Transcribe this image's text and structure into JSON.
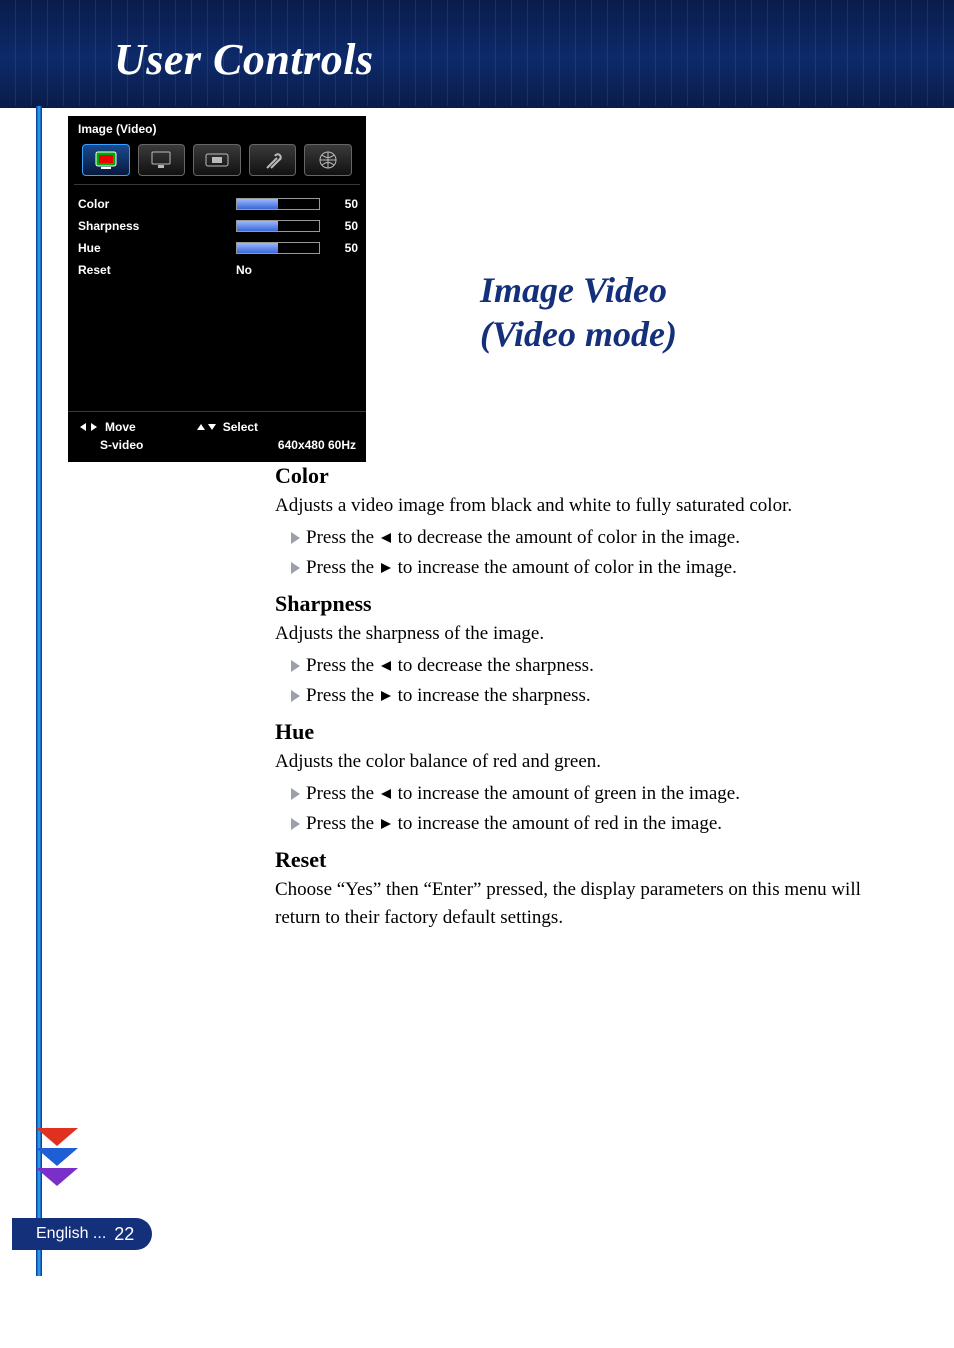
{
  "header": {
    "section_title": "User Controls"
  },
  "osd": {
    "title": "Image (Video)",
    "tabs": [
      {
        "name": "image-video-tab",
        "active": true
      },
      {
        "name": "display-tab",
        "active": false
      },
      {
        "name": "aspect-tab",
        "active": false
      },
      {
        "name": "setup-tab",
        "active": false
      },
      {
        "name": "language-tab",
        "active": false
      }
    ],
    "rows": [
      {
        "label": "Color",
        "type": "slider",
        "value": 50
      },
      {
        "label": "Sharpness",
        "type": "slider",
        "value": 50
      },
      {
        "label": "Hue",
        "type": "slider",
        "value": 50
      },
      {
        "label": "Reset",
        "type": "text",
        "text": "No"
      }
    ],
    "footer": {
      "move_label": "Move",
      "select_label": "Select",
      "source": "S-video",
      "resolution": "640x480 60Hz"
    }
  },
  "doc": {
    "heading_line1": "Image Video",
    "heading_line2": "(Video mode)",
    "sections": [
      {
        "title": "Color",
        "intro": "Adjusts a video image from black and white to fully saturated color.",
        "bullets": [
          {
            "pre": "Press the ",
            "dir": "left",
            "post": " to decrease the amount of color in the image."
          },
          {
            "pre": "Press the ",
            "dir": "right",
            "post": " to increase the amount of color in the image."
          }
        ]
      },
      {
        "title": "Sharpness",
        "intro": "Adjusts the sharpness of the image.",
        "bullets": [
          {
            "pre": "Press the ",
            "dir": "left",
            "post": " to decrease the sharpness."
          },
          {
            "pre": "Press the ",
            "dir": "right",
            "post": " to increase the sharpness."
          }
        ]
      },
      {
        "title": "Hue",
        "intro": "Adjusts the color balance of red and green.",
        "bullets": [
          {
            "pre": "Press the ",
            "dir": "left",
            "post": " to increase the amount of green in the image."
          },
          {
            "pre": "Press the ",
            "dir": "right",
            "post": " to increase the amount of red  in the image."
          }
        ]
      },
      {
        "title": "Reset",
        "intro": "Choose “Yes” then “Enter” pressed, the display parameters on this menu will return to their factory default settings.",
        "bullets": []
      }
    ]
  },
  "footer": {
    "lang_label": "English ...",
    "page_number": "22"
  }
}
